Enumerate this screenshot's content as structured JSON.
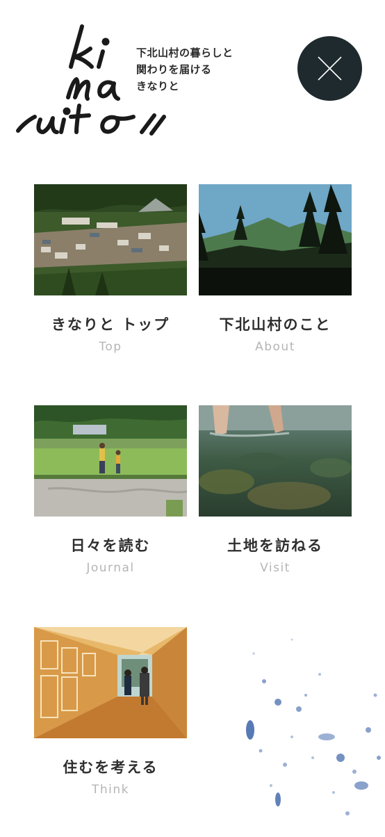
{
  "header": {
    "logo_text": "kinaito",
    "tagline": [
      "下北山村の暮らしと",
      "関わりを届ける",
      "きなりと"
    ],
    "close_icon": "close-icon"
  },
  "menu": [
    {
      "id": "top",
      "label": "きなりと トップ",
      "sub": "Top",
      "image": "village-photo"
    },
    {
      "id": "about",
      "label": "下北山村のこと",
      "sub": "About",
      "image": "mountain-photo"
    },
    {
      "id": "journal",
      "label": "日々を読む",
      "sub": "Journal",
      "image": "field-photo"
    },
    {
      "id": "visit",
      "label": "土地を訪ねる",
      "sub": "Visit",
      "image": "river-photo"
    },
    {
      "id": "think",
      "label": "住むを考える",
      "sub": "Think",
      "image": "hallway-photo"
    }
  ],
  "colors": {
    "close_bg": "#1f2a2e",
    "label": "#2e2e2e",
    "sublabel": "#b5b5b5",
    "splash": "#3a63a8"
  }
}
